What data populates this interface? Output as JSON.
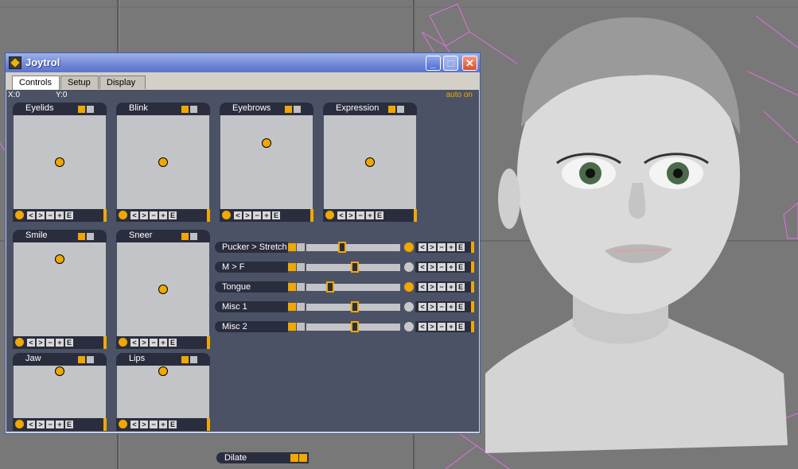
{
  "window": {
    "title": "Joytrol",
    "tabs": [
      "Controls",
      "Setup",
      "Display"
    ],
    "active_tab": "Controls",
    "x_readout": "X:0",
    "y_readout": "Y:0",
    "auto_status": "auto on"
  },
  "foot_buttons": [
    "<",
    ">",
    "−",
    "+",
    "E"
  ],
  "pads": [
    {
      "label": "Eyelids",
      "dot_x": 0.5,
      "dot_y": 0.5
    },
    {
      "label": "Blink",
      "dot_x": 0.5,
      "dot_y": 0.5
    },
    {
      "label": "Eyebrows",
      "dot_x": 0.5,
      "dot_y": 0.3
    },
    {
      "label": "Expression",
      "dot_x": 0.5,
      "dot_y": 0.5
    },
    {
      "label": "Smile",
      "dot_x": 0.5,
      "dot_y": 0.18
    },
    {
      "label": "Sneer",
      "dot_x": 0.5,
      "dot_y": 0.5
    },
    {
      "label": "Jaw",
      "dot_x": 0.5,
      "dot_y": 0.1
    },
    {
      "label": "Lips",
      "dot_x": 0.5,
      "dot_y": 0.1
    }
  ],
  "sliders": [
    {
      "label": "Pucker > Stretch",
      "value": 0.38,
      "active": true
    },
    {
      "label": "M > F",
      "value": 0.52,
      "active": false
    },
    {
      "label": "Tongue",
      "value": 0.25,
      "active": true
    },
    {
      "label": "Misc 1",
      "value": 0.52,
      "active": false
    },
    {
      "label": "Misc 2",
      "value": 0.52,
      "active": false
    }
  ],
  "dilate": {
    "label": "Dilate"
  },
  "colors": {
    "accent": "#f0a800",
    "panel": "#4c5265",
    "widget_dark": "#2a2d3e",
    "pad_bg": "#c3c4c8"
  }
}
